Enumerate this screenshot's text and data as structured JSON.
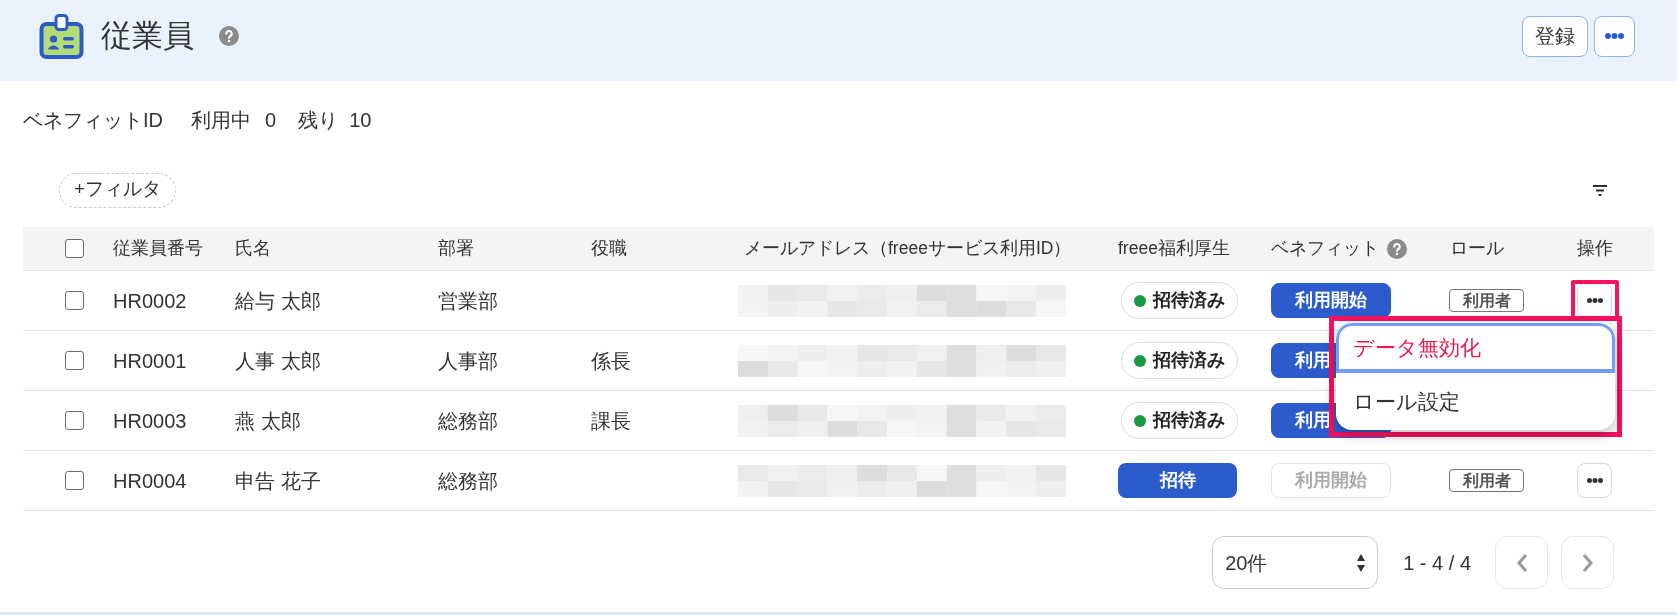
{
  "header": {
    "title": "従業員",
    "help": true,
    "register_button": "登録",
    "more_button": true
  },
  "benefit_summary": {
    "label": "ベネフィットID",
    "items": [
      {
        "label": "利用中",
        "value": "0"
      },
      {
        "label": "残り",
        "value": "10"
      }
    ]
  },
  "toolbar": {
    "filter_button": "+フィルタ",
    "display_settings": true
  },
  "table": {
    "select_all": {
      "checked": false
    },
    "columns": [
      {
        "label": "従業員番号",
        "help": false
      },
      {
        "label": "氏名",
        "help": false
      },
      {
        "label": "部署",
        "help": false
      },
      {
        "label": "役職",
        "help": false
      },
      {
        "label": "メールアドレス（freeeサービス利用ID）",
        "help": false
      },
      {
        "label": "freee福利厚生",
        "help": false
      },
      {
        "label": "ベネフィット",
        "help": true
      },
      {
        "label": "ロール",
        "help": false
      },
      {
        "label": "操作",
        "help": false
      }
    ],
    "rows": [
      {
        "checked": false,
        "employee_no": "HR0002",
        "name": "給与 太郎",
        "department": "営業部",
        "email_redacted": true,
        "welfare": {
          "kind": "status",
          "label": "招待済み"
        },
        "benefit": {
          "label": "利用開始",
          "disabled": false
        },
        "role": "利用者",
        "action_button": true,
        "highlighted": true,
        "menu": {
          "highlighted": true,
          "items": [
            {
              "label": "データ無効化",
              "kind": "danger",
              "focused": true
            },
            {
              "label": "ロール設定",
              "kind": "normal",
              "focused": false
            }
          ]
        }
      },
      {
        "checked": false,
        "employee_no": "HR0001",
        "name": "人事 太郎",
        "department": "人事部",
        "position": "係長",
        "email_redacted": true,
        "welfare": {
          "kind": "status",
          "label": "招待済み"
        },
        "benefit": {
          "label": "利用",
          "disabled": false
        },
        "action_button": false
      },
      {
        "checked": false,
        "employee_no": "HR0003",
        "name": "燕 太郎",
        "department": "総務部",
        "position": "課長",
        "email_redacted": true,
        "welfare": {
          "kind": "status",
          "label": "招待済み"
        },
        "benefit": {
          "label": "利用",
          "disabled": false
        },
        "action_button": false
      },
      {
        "checked": false,
        "employee_no": "HR0004",
        "name": "申告 花子",
        "department": "総務部",
        "email_redacted": true,
        "welfare": {
          "kind": "button",
          "label": "招待"
        },
        "benefit": {
          "label": "利用開始",
          "disabled": true
        },
        "role": "利用者",
        "action_button": true,
        "highlighted": false
      }
    ]
  },
  "pagination": {
    "page_size": "20件",
    "range": "1 - 4 / 4",
    "prev_disabled": true,
    "next_disabled": true
  }
}
